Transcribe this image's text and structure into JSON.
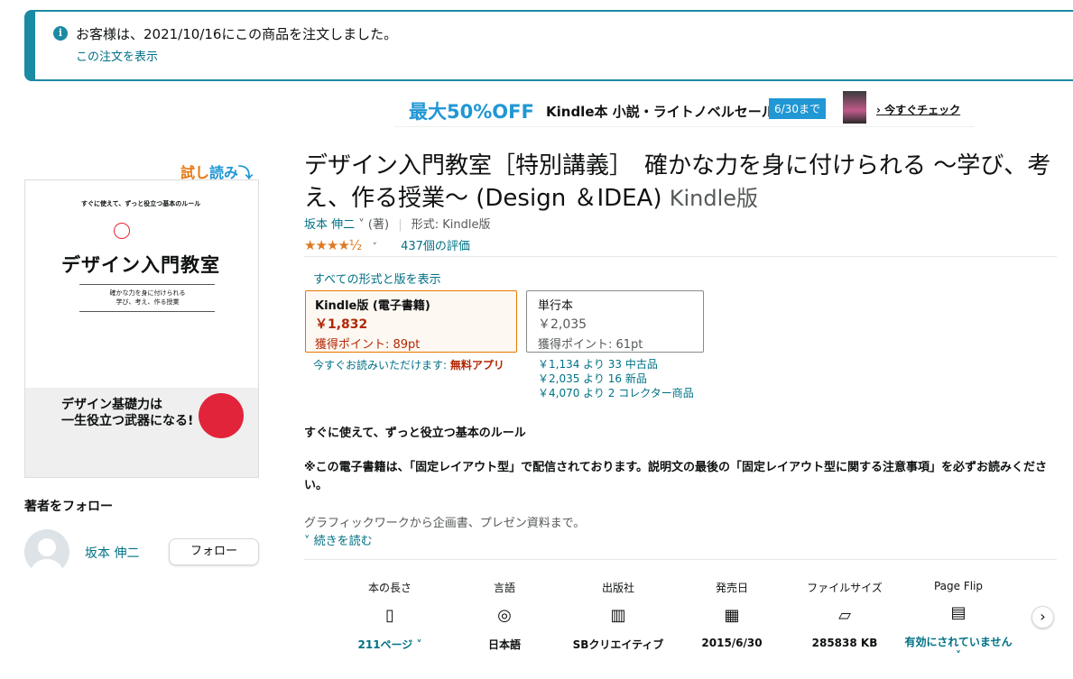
{
  "alert": {
    "icon": "info-icon",
    "message": "お客様は、2021/10/16にこの商品を注文しました。",
    "view_order_link": "この注文を表示"
  },
  "banner": {
    "discount": "最大50%OFF",
    "text": "Kindle本 小説・ライトノベルセール",
    "until": "6/30まで",
    "check": "今すぐチェック"
  },
  "trial": {
    "part1": "試し",
    "part2": "読み"
  },
  "cover": {
    "subtitle": "すぐに使えて、ずっと役立つ基本のルール",
    "title": "デザイン入門教室",
    "small": "確かな力を身に付けられる\n学び、考え、作る授業",
    "bottom_text": "デザイン基礎力は\n一生役立つ武器になる!"
  },
  "follow": {
    "heading": "著者をフォロー",
    "author": "坂本 伸二",
    "button": "フォロー"
  },
  "product": {
    "title": "デザイン入門教室［特別講義］　確かな力を身に付けられる ～学び、考え、作る授業～ (Design ＆IDEA)",
    "format_suffix": "Kindle版",
    "author": "坂本 伸二",
    "role": "(著)",
    "format_label": "形式: Kindle版",
    "stars": "★★★★½",
    "rating_count": "437個の評価"
  },
  "formats": {
    "all_link": "すべての形式と版を表示",
    "kindle": {
      "name": "Kindle版 (電子書籍)",
      "price": "￥1,832",
      "points": "獲得ポイント: 89pt"
    },
    "paper": {
      "name": "単行本",
      "price": "￥2,035",
      "points": "獲得ポイント: 61pt"
    },
    "read_now": "今すぐお読みいただけます: ",
    "free_app": "無料アプリ",
    "offers": [
      "￥1,134 より 33 中古品",
      "￥2,035 より 16 新品",
      "￥4,070 より 2 コレクター商品"
    ]
  },
  "description": {
    "bold_line": "すぐに使えて、ずっと役立つ基本のルール",
    "note": "※この電子書籍は、「固定レイアウト型」で配信されております。説明文の最後の「固定レイアウト型に関する注意事項」を必ずお読みください。",
    "text": "グラフィックワークから企画書、プレゼン資料まで。",
    "read_more": "続きを読む"
  },
  "details": [
    {
      "label": "本の長さ",
      "icon": "book-pages-icon",
      "value": "211ページ ˅"
    },
    {
      "label": "言語",
      "icon": "globe-icon",
      "value": "日本語"
    },
    {
      "label": "出版社",
      "icon": "building-icon",
      "value": "SBクリエイティブ"
    },
    {
      "label": "発売日",
      "icon": "calendar-icon",
      "value": "2015/6/30"
    },
    {
      "label": "ファイルサイズ",
      "icon": "file-icon",
      "value": "285838 KB"
    },
    {
      "label": "Page Flip",
      "icon": "page-flip-icon",
      "value": "有効にされていません ˅"
    }
  ],
  "colors": {
    "link": "#007185",
    "price": "#b12704",
    "accent_blue": "#2197d4",
    "alert_border": "#1b8aa3"
  }
}
